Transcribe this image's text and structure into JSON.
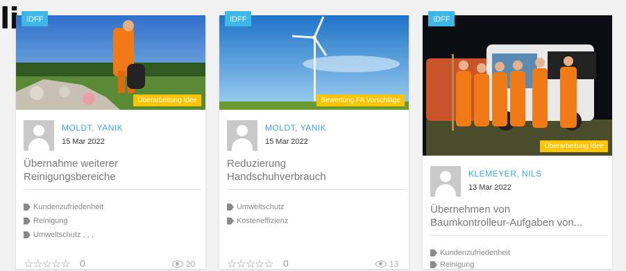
{
  "header": {
    "clipped_title": "li"
  },
  "cards": [
    {
      "badge": "IDFF",
      "status": "Überarbeitung Idee",
      "author": "MOLDT, YANIK",
      "date": "15 Mar 2022",
      "title_line1": "Übernahme weiterer",
      "title_line2": "Reinigungsbereiche",
      "tags": [
        "Kundenzufriedenheit",
        "Reinigung",
        "Umweltschutz , , ,"
      ],
      "stars": "☆☆☆☆☆",
      "rating_count": "0",
      "views": "20",
      "image_icon": "worker-field-photo"
    },
    {
      "badge": "IDFF",
      "status": "Bewertung FA Vorschläge",
      "author": "MOLDT, YANIK",
      "date": "15 Mar 2022",
      "title_line1": "Reduzierung",
      "title_line2": "Handschuhverbrauch",
      "tags": [
        "Umweltschutz",
        "Kosteneffizienz"
      ],
      "stars": "☆☆☆☆☆",
      "rating_count": "0",
      "views": "13",
      "image_icon": "wind-turbine-photo"
    },
    {
      "badge": "IDFF",
      "status": "Überarbeitung Idee",
      "author": "KLEMEYER, NILS",
      "date": "13 Mar 2022",
      "title_line1": "Übernehmen von",
      "title_line2": "Baumkontrolleur-Aufgaben von...",
      "tags": [
        "Kundenzufriedenheit",
        "Reinigung"
      ],
      "image_icon": "team-night-photo"
    }
  ]
}
